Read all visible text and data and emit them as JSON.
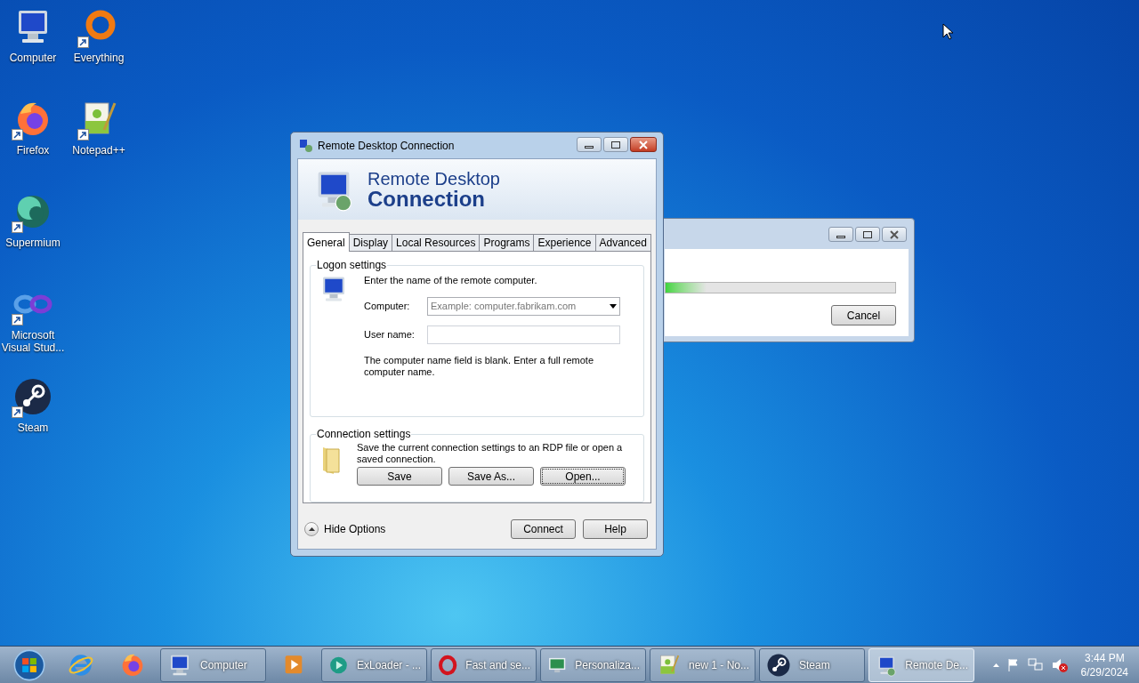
{
  "desktop_icons": [
    {
      "label": "Computer",
      "kind": "computer",
      "shortcut": false
    },
    {
      "label": "Everything",
      "kind": "everything",
      "shortcut": true
    },
    {
      "label": "Firefox",
      "kind": "firefox",
      "shortcut": true
    },
    {
      "label": "Notepad++",
      "kind": "notepad",
      "shortcut": true
    },
    {
      "label": "Supermium",
      "kind": "supermium",
      "shortcut": true
    },
    {
      "label": "Microsoft Visual Stud...",
      "kind": "vs",
      "shortcut": true
    },
    {
      "label": "Steam",
      "kind": "steam",
      "shortcut": true
    }
  ],
  "back_window": {
    "progress": {
      "level": 0.18
    },
    "button": "Cancel"
  },
  "dialog": {
    "title": "Remote Desktop Connection",
    "banner": {
      "line1": "Remote Desktop",
      "line2": "Connection"
    },
    "tabs": [
      {
        "label": "General",
        "selected": true
      },
      {
        "label": "Display",
        "selected": false
      },
      {
        "label": "Local Resources",
        "selected": false
      },
      {
        "label": "Programs",
        "selected": false
      },
      {
        "label": "Experience",
        "selected": false
      },
      {
        "label": "Advanced",
        "selected": false
      }
    ],
    "logon": {
      "legend": "Logon settings",
      "intro": "Enter the name of the remote computer.",
      "computer_label": "Computer:",
      "computer_placeholder": "Example: computer.fabrikam.com",
      "user_label": "User name:",
      "note": "The computer name field is blank. Enter a full remote computer name."
    },
    "connection": {
      "legend": "Connection settings",
      "text": "Save the current connection settings to an RDP file or open a saved connection.",
      "buttons": [
        {
          "label": "Save",
          "focused": false
        },
        {
          "label": "Save As...",
          "focused": false
        },
        {
          "label": "Open...",
          "focused": true
        }
      ]
    },
    "footer": {
      "toggle": "Hide Options",
      "buttons": [
        "Connect",
        "Help"
      ]
    }
  },
  "taskbar": {
    "items": [
      {
        "kind": "start"
      },
      {
        "kind": "ie"
      },
      {
        "kind": "firefox"
      },
      {
        "kind": "computer",
        "label": "Computer",
        "selected": false
      },
      {
        "kind": "mediaplayer"
      },
      {
        "kind": "exloader",
        "label": "ExLoader - ...",
        "selected": false
      },
      {
        "kind": "opera",
        "label": "Fast and se...",
        "selected": false
      },
      {
        "kind": "personalize",
        "label": "Personaliza...",
        "selected": false
      },
      {
        "kind": "notepad",
        "label": "new 1 - No...",
        "selected": false
      },
      {
        "kind": "steam",
        "label": "Steam",
        "selected": false
      },
      {
        "kind": "rdp",
        "label": "Remote De...",
        "selected": true
      }
    ],
    "clock": {
      "time": "3:44 PM",
      "date": "6/29/2024"
    }
  }
}
